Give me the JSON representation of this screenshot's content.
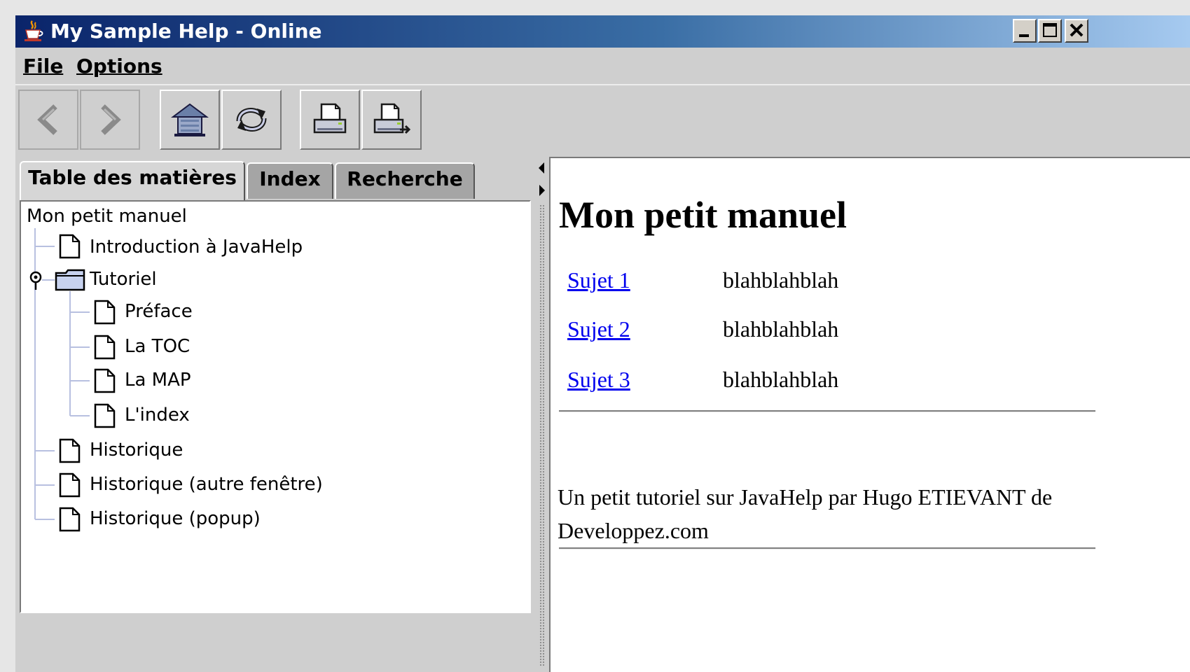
{
  "window": {
    "title": "My Sample Help - Online",
    "controls": [
      "minimize",
      "maximize",
      "close"
    ]
  },
  "menubar": {
    "items": [
      {
        "label": "File",
        "mnemonic": "F"
      },
      {
        "label": "Options",
        "mnemonic": "O"
      }
    ]
  },
  "toolbar": {
    "buttons": [
      {
        "name": "back",
        "icon": "chevron-left-icon",
        "enabled": false
      },
      {
        "name": "forward",
        "icon": "chevron-right-icon",
        "enabled": false
      },
      {
        "name": "home",
        "icon": "home-icon",
        "enabled": true
      },
      {
        "name": "reload",
        "icon": "reload-icon",
        "enabled": true
      },
      {
        "name": "print",
        "icon": "printer-icon",
        "enabled": true
      },
      {
        "name": "print-setup",
        "icon": "printer-setup-icon",
        "enabled": true
      }
    ]
  },
  "navigator": {
    "tabs": [
      {
        "label": "Table des matières",
        "active": true
      },
      {
        "label": "Index",
        "active": false
      },
      {
        "label": "Recherche",
        "active": false
      }
    ],
    "tree": {
      "root": "Mon petit manuel",
      "items": [
        {
          "label": "Introduction à JavaHelp",
          "type": "document",
          "level": 1
        },
        {
          "label": "Tutoriel",
          "type": "folder",
          "level": 1,
          "expanded": true
        },
        {
          "label": "Préface",
          "type": "document",
          "level": 2
        },
        {
          "label": "La TOC",
          "type": "document",
          "level": 2
        },
        {
          "label": "La MAP",
          "type": "document",
          "level": 2
        },
        {
          "label": "L'index",
          "type": "document",
          "level": 2
        },
        {
          "label": "Historique",
          "type": "document",
          "level": 1
        },
        {
          "label": "Historique (autre fenêtre)",
          "type": "document",
          "level": 1
        },
        {
          "label": "Historique (popup)",
          "type": "document",
          "level": 1
        }
      ]
    }
  },
  "content": {
    "heading": "Mon petit manuel",
    "topics": [
      {
        "link": "Sujet 1",
        "desc": "blahblahblah"
      },
      {
        "link": "Sujet 2",
        "desc": "blahblahblah"
      },
      {
        "link": "Sujet 3",
        "desc": "blahblahblah"
      }
    ],
    "footer_text": "Un petit tutoriel sur JavaHelp par Hugo ETIEVANT de Developpez.com"
  },
  "colors": {
    "titlebar_start": "#0a246a",
    "titlebar_end": "#a6caf0",
    "link": "#0000ee",
    "panel_bg": "#cfcfcf"
  }
}
